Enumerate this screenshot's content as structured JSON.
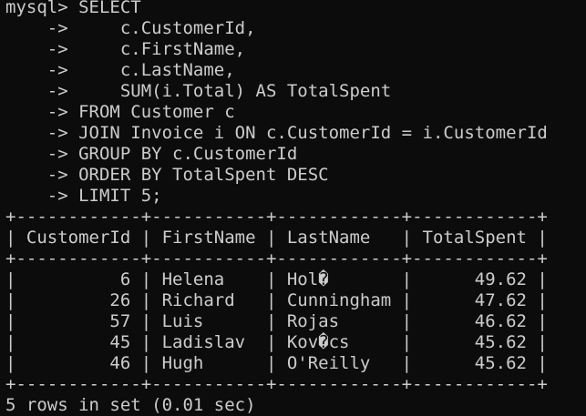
{
  "terminal": {
    "query_lines": [
      "mysql> SELECT",
      "    ->     c.CustomerId,",
      "    ->     c.FirstName,",
      "    ->     c.LastName,",
      "    ->     SUM(i.Total) AS TotalSpent",
      "    -> FROM Customer c",
      "    -> JOIN Invoice i ON c.CustomerId = i.CustomerId",
      "    -> GROUP BY c.CustomerId",
      "    -> ORDER BY TotalSpent DESC",
      "    -> LIMIT 5;"
    ],
    "table": {
      "border": "+------------+-----------+------------+------------+",
      "header": "| CustomerId | FirstName | LastName   | TotalSpent |",
      "columns": [
        "CustomerId",
        "FirstName",
        "LastName",
        "TotalSpent"
      ],
      "rows": [
        [
          "6",
          "Helena",
          "Hol�",
          "49.62"
        ],
        [
          "26",
          "Richard",
          "Cunningham",
          "47.62"
        ],
        [
          "57",
          "Luis",
          "Rojas",
          "46.62"
        ],
        [
          "45",
          "Ladislav",
          "Kov�cs",
          "45.62"
        ],
        [
          "46",
          "Hugh",
          "O'Reilly",
          "45.62"
        ]
      ],
      "row_lines": [
        "|          6 | Helena    | Hol�       |      49.62 |",
        "|         26 | Richard   | Cunningham |      47.62 |",
        "|         57 | Luis      | Rojas      |      46.62 |",
        "|         45 | Ladislav  | Kov�cs     |      45.62 |",
        "|         46 | Hugh      | O'Reilly   |      45.62 |"
      ]
    },
    "result_summary": "5 rows in set (0.01 sec)",
    "colors": {
      "background": "#0c0c0c",
      "foreground": "#cccccc"
    }
  }
}
